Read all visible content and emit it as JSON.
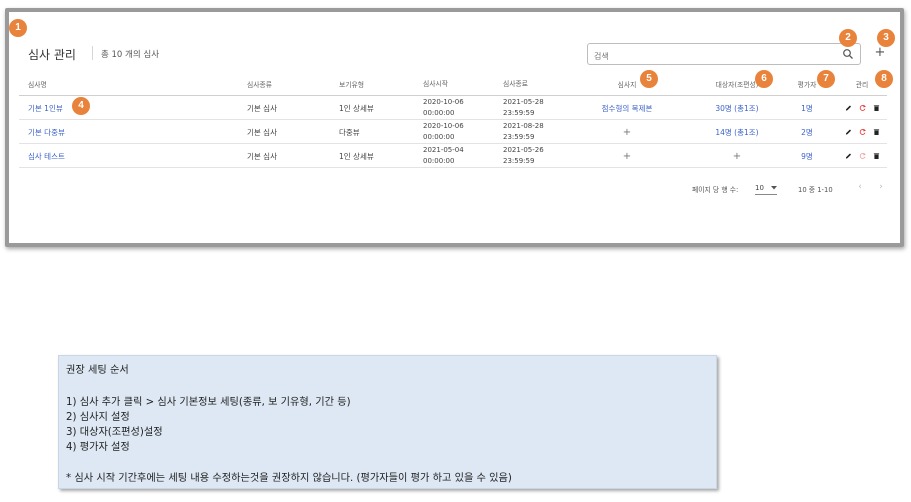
{
  "header": {
    "title": "심사 관리",
    "count": "총 10 개의 심사",
    "search_placeholder": "검색",
    "add_label": "+"
  },
  "table": {
    "columns": [
      "심사명",
      "심사종류",
      "보기유형",
      "심사시작",
      "심사종료",
      "심사지",
      "대상자(조편성)",
      "평가자",
      "관리"
    ],
    "rows": [
      {
        "name": "기본 1인뷰",
        "type": "기본 심사",
        "view": "1인 상세뷰",
        "start_date": "2020-10-06",
        "start_time": "00:00:00",
        "end_date": "2021-05-28",
        "end_time": "23:59:59",
        "sheet": "점수형의 복제본",
        "targets": "30명 (총1조)",
        "evaluators": "1명"
      },
      {
        "name": "기본 다중뷰",
        "type": "기본 심사",
        "view": "다중뷰",
        "start_date": "2020-10-06",
        "start_time": "00:00:00",
        "end_date": "2021-08-28",
        "end_time": "23:59:59",
        "sheet": "+",
        "targets": "14명 (총1조)",
        "evaluators": "2명"
      },
      {
        "name": "심사 테스트",
        "type": "기본 심사",
        "view": "1인 상세뷰",
        "start_date": "2021-05-04",
        "start_time": "00:00:00",
        "end_date": "2021-05-26",
        "end_time": "23:59:59",
        "sheet": "+",
        "targets": "+",
        "evaluators": "9명"
      }
    ]
  },
  "footer": {
    "per_page_label": "페이지 당 행 수:",
    "per_page_value": "10",
    "range": "10 중 1-10",
    "prev": "‹",
    "next": "›"
  },
  "badges": [
    "1",
    "2",
    "3",
    "4",
    "5",
    "6",
    "7",
    "8"
  ],
  "note": {
    "title": "권장 세팅 순서",
    "steps": [
      "1)    심사 추가 클릭 > 심사 기본정보 세팅(종류, 보 기유형, 기간 등)",
      "2)    심사지 설정",
      "3)    대상자(조편성)설정",
      "4)    평가자 설정"
    ],
    "warning": "* 심사 시작 기간후에는 세팅 내용 수정하는것을 권장하지 않습니다. (평가자들이 평가 하고 있을 수 있음)"
  },
  "colors": {
    "accent": "#3d63c9",
    "badge": "#e9823a",
    "note_bg": "#dde8f4",
    "refresh": "#e53935"
  }
}
